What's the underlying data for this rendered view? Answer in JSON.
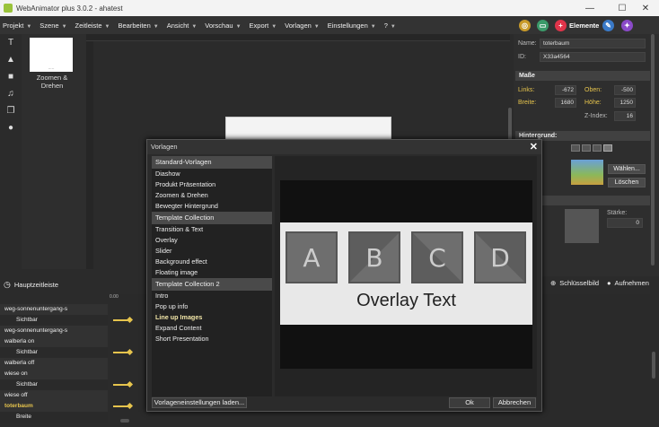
{
  "window": {
    "title": "WebAnimator plus 3.0.2 - ahatest",
    "minimize": "—",
    "maximize": "☐",
    "close": "✕"
  },
  "menu": [
    {
      "label": "Projekt"
    },
    {
      "label": "Szene"
    },
    {
      "label": "Zeitleiste"
    },
    {
      "label": "Bearbeiten"
    },
    {
      "label": "Ansicht"
    },
    {
      "label": "Vorschau"
    },
    {
      "label": "Export"
    },
    {
      "label": "Vorlagen"
    },
    {
      "label": "Einstellungen"
    },
    {
      "label": "?"
    }
  ],
  "toolbar": {
    "elements_label": "Elemente"
  },
  "scene": {
    "thumb_label": "Zoomen &\nDrehen",
    "thumb_dots": "....."
  },
  "properties": {
    "name_label": "Name:",
    "name_value": "toterbaum",
    "id_label": "ID:",
    "id_value": "X33a4564",
    "masse_header": "Maße",
    "links_label": "Links:",
    "links_value": "-672",
    "oben_label": "Oben:",
    "oben_value": "-500",
    "breite_label": "Breite:",
    "breite_value": "1680",
    "hoehe_label": "Höhe:",
    "hoehe_value": "1250",
    "zindex_label": "Z-Index:",
    "zindex_value": "16",
    "bg_header": "Hintergrund:",
    "choose_button": "Wählen...",
    "delete_button": "Löschen",
    "staerke_label": "Stärke:",
    "staerke_value": "0"
  },
  "timeline": {
    "header": "Hauptzeitleiste",
    "ruler_mark": "0.00",
    "keyframe_button": "Schlüsselbild",
    "record_button": "Aufnehmen",
    "tracks": [
      {
        "label": "weg-sonnenuntergang-s",
        "type": "main"
      },
      {
        "label": "Sichtbar",
        "type": "sub"
      },
      {
        "label": "weg-sonnenuntergang-s",
        "type": "main"
      },
      {
        "label": "walberla on",
        "type": "main"
      },
      {
        "label": "Sichtbar",
        "type": "sub"
      },
      {
        "label": "walberla off",
        "type": "main"
      },
      {
        "label": "wiese on",
        "type": "main"
      },
      {
        "label": "Sichtbar",
        "type": "sub"
      },
      {
        "label": "wiese off",
        "type": "main"
      },
      {
        "label": "toterbaum",
        "type": "main-hl"
      },
      {
        "label": "Breite",
        "type": "sub"
      }
    ]
  },
  "dialog": {
    "title": "Vorlagen",
    "close": "✕",
    "groups": [
      {
        "name": "Standard-Vorlagen",
        "items": [
          "Diashow",
          "Produkt Präsentation",
          "Zoomen & Drehen",
          "Bewegter Hintergrund"
        ]
      },
      {
        "name": "Template Collection",
        "items": [
          "Transition & Text",
          "Overlay",
          "Slider",
          "Background effect",
          "Floating image"
        ]
      },
      {
        "name": "Template Collection 2",
        "items": [
          "Intro",
          "Pop up info",
          "Line up Images",
          "Expand Content",
          "Short Presentation"
        ]
      }
    ],
    "selected_item": "Line up Images",
    "preview": {
      "tiles": [
        "A",
        "B",
        "C",
        "D"
      ],
      "overlay_text": "Overlay Text"
    },
    "load_settings_button": "Vorlageneinstellungen laden...",
    "ok_button": "Ok",
    "cancel_button": "Abbrechen"
  },
  "colors": {
    "accent": "#e6c44d",
    "bg": "#2b2b2b",
    "dialog_group": "#4a4a4a"
  }
}
